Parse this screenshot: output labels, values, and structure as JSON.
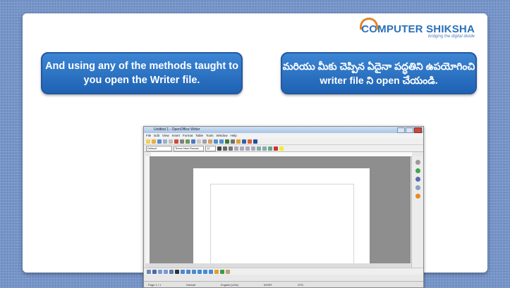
{
  "logo": {
    "brand_part1": "COMPUTER",
    "brand_part2": "SHIKSHA",
    "tagline": "bridging the digital divide"
  },
  "callouts": {
    "english": "And using any of the methods taught to you open the Writer file.",
    "telugu": "మరియు మీకు చెప్పిన ఏదైనా పద్ధతిని ఉపయోగించి writer file ని open చేయండి."
  },
  "writer_window": {
    "title": "Untitled 1 - OpenOffice Writer",
    "menu": [
      "File",
      "Edit",
      "View",
      "Insert",
      "Format",
      "Table",
      "Tools",
      "Window",
      "Help"
    ],
    "paragraph_style": "Default",
    "font_name": "Times New Roman",
    "font_size": "12",
    "status": {
      "page": "Page 1 / 1",
      "style": "Default",
      "language": "English (USA)",
      "mode": "INSRT",
      "selection": "STD"
    }
  },
  "colors": {
    "background": "#6f8fc4",
    "callout_blue": "#2a6fc2",
    "logo_blue": "#2a6fb8",
    "logo_orange": "#e0862b"
  }
}
